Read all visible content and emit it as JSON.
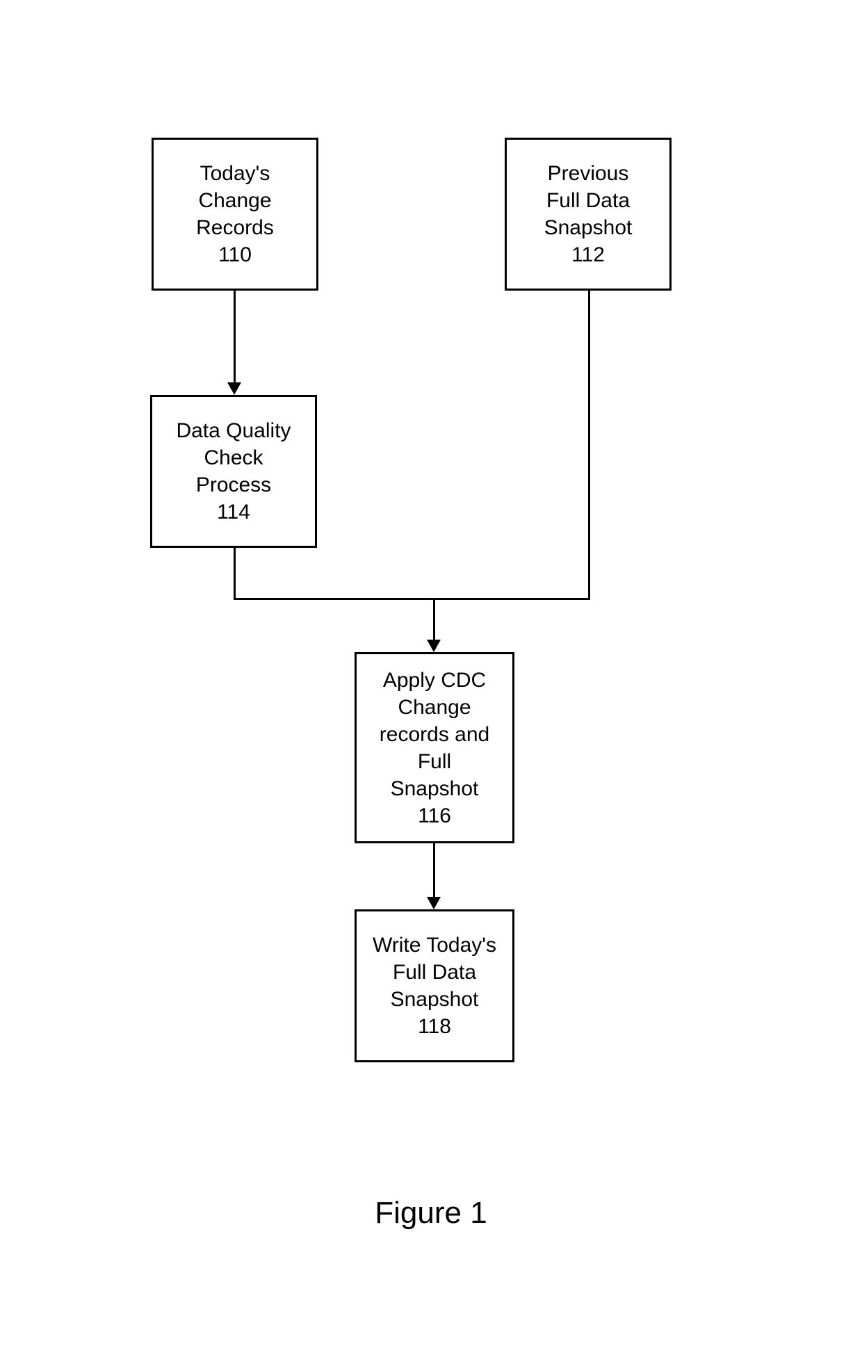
{
  "boxes": {
    "todays_change": {
      "line1": "Today's",
      "line2": "Change",
      "line3": "Records",
      "num": "110"
    },
    "previous_snapshot": {
      "line1": "Previous",
      "line2": "Full Data",
      "line3": "Snapshot",
      "num": "112"
    },
    "data_quality": {
      "line1": "Data Quality",
      "line2": "Check",
      "line3": "Process",
      "num": "114"
    },
    "apply_cdc": {
      "line1": "Apply CDC",
      "line2": "Change",
      "line3": "records and",
      "line4": "Full",
      "line5": "Snapshot",
      "num": "116"
    },
    "write_today": {
      "line1": "Write Today's",
      "line2": "Full Data",
      "line3": "Snapshot",
      "num": "118"
    }
  },
  "figure_label": "Figure 1"
}
